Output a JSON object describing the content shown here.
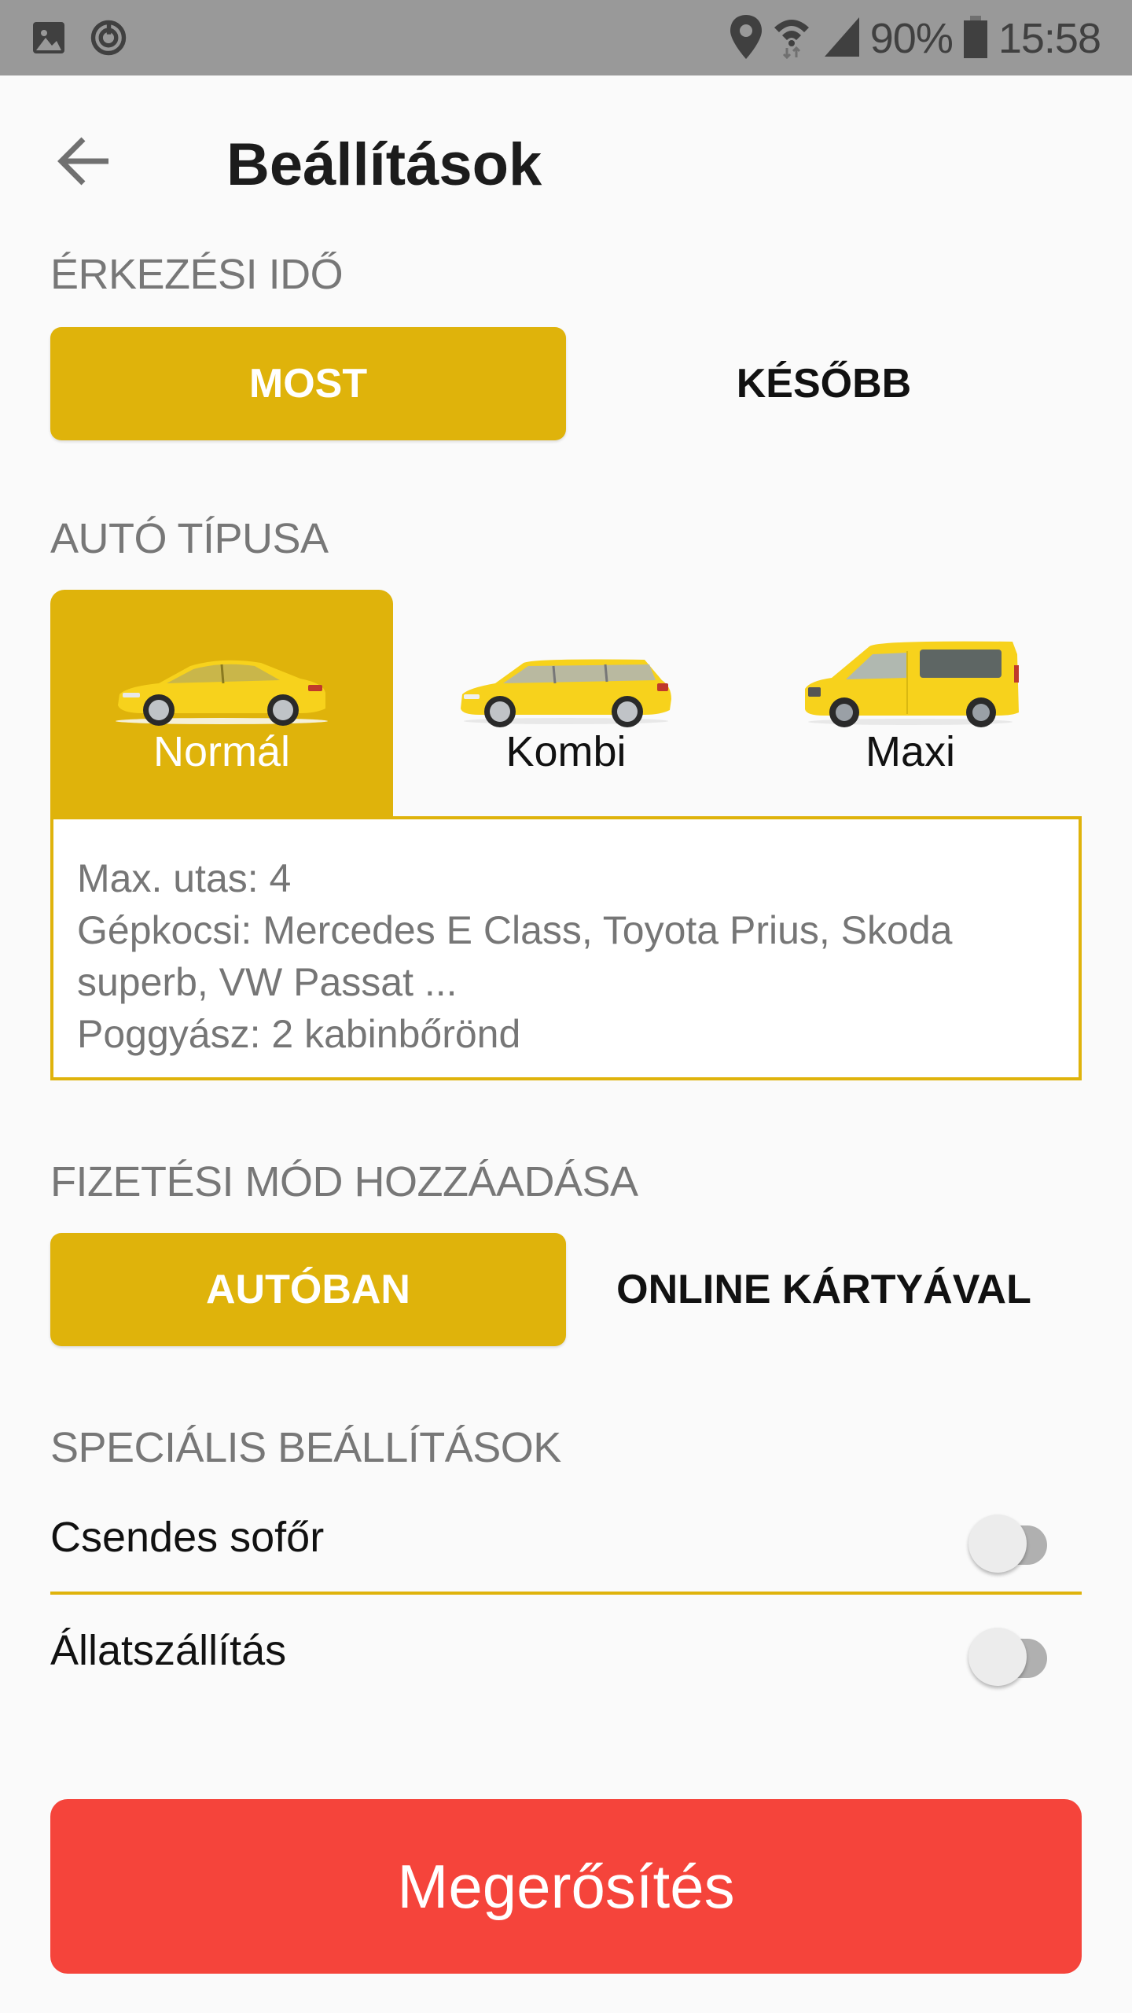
{
  "status_bar": {
    "left_icons": [
      "image-icon",
      "sync-icon"
    ],
    "right_icons": [
      "location-icon",
      "wifi-icon",
      "signal-icon"
    ],
    "battery_percent": "90%",
    "time": "15:58"
  },
  "header": {
    "back_icon": "arrow-left-icon",
    "title": "Beállítások"
  },
  "arrival_time": {
    "label": "ÉRKEZÉSI IDŐ",
    "options": [
      {
        "label": "MOST",
        "selected": true
      },
      {
        "label": "KÉSŐBB",
        "selected": false
      }
    ]
  },
  "car_type": {
    "label": "AUTÓ TÍPUSA",
    "options": [
      {
        "label": "Normál",
        "icon": "sedan-car-icon",
        "selected": true
      },
      {
        "label": "Kombi",
        "icon": "station-wagon-car-icon",
        "selected": false
      },
      {
        "label": "Maxi",
        "icon": "van-car-icon",
        "selected": false
      }
    ],
    "details": [
      "Max. utas: 4",
      "Gépkocsi: Mercedes E Class, Toyota Prius, Skoda superb, VW Passat ...",
      "Poggyász: 2 kabinbőrönd"
    ]
  },
  "payment": {
    "label": "FIZETÉSI MÓD HOZZÁADÁSA",
    "options": [
      {
        "label": "AUTÓBAN",
        "selected": true
      },
      {
        "label": "ONLINE KÁRTYÁVAL",
        "selected": false
      }
    ]
  },
  "special": {
    "label": "SPECIÁLIS BEÁLLÍTÁSOK",
    "items": [
      {
        "label": "Csendes sofőr",
        "enabled": false
      },
      {
        "label": "Állatszállítás",
        "enabled": false
      }
    ]
  },
  "confirm_button": {
    "label": "Megerősítés"
  },
  "colors": {
    "accent": "#dfb30b",
    "confirm": "#f5443b",
    "status_bar": "#999999",
    "background": "#fafafa"
  }
}
